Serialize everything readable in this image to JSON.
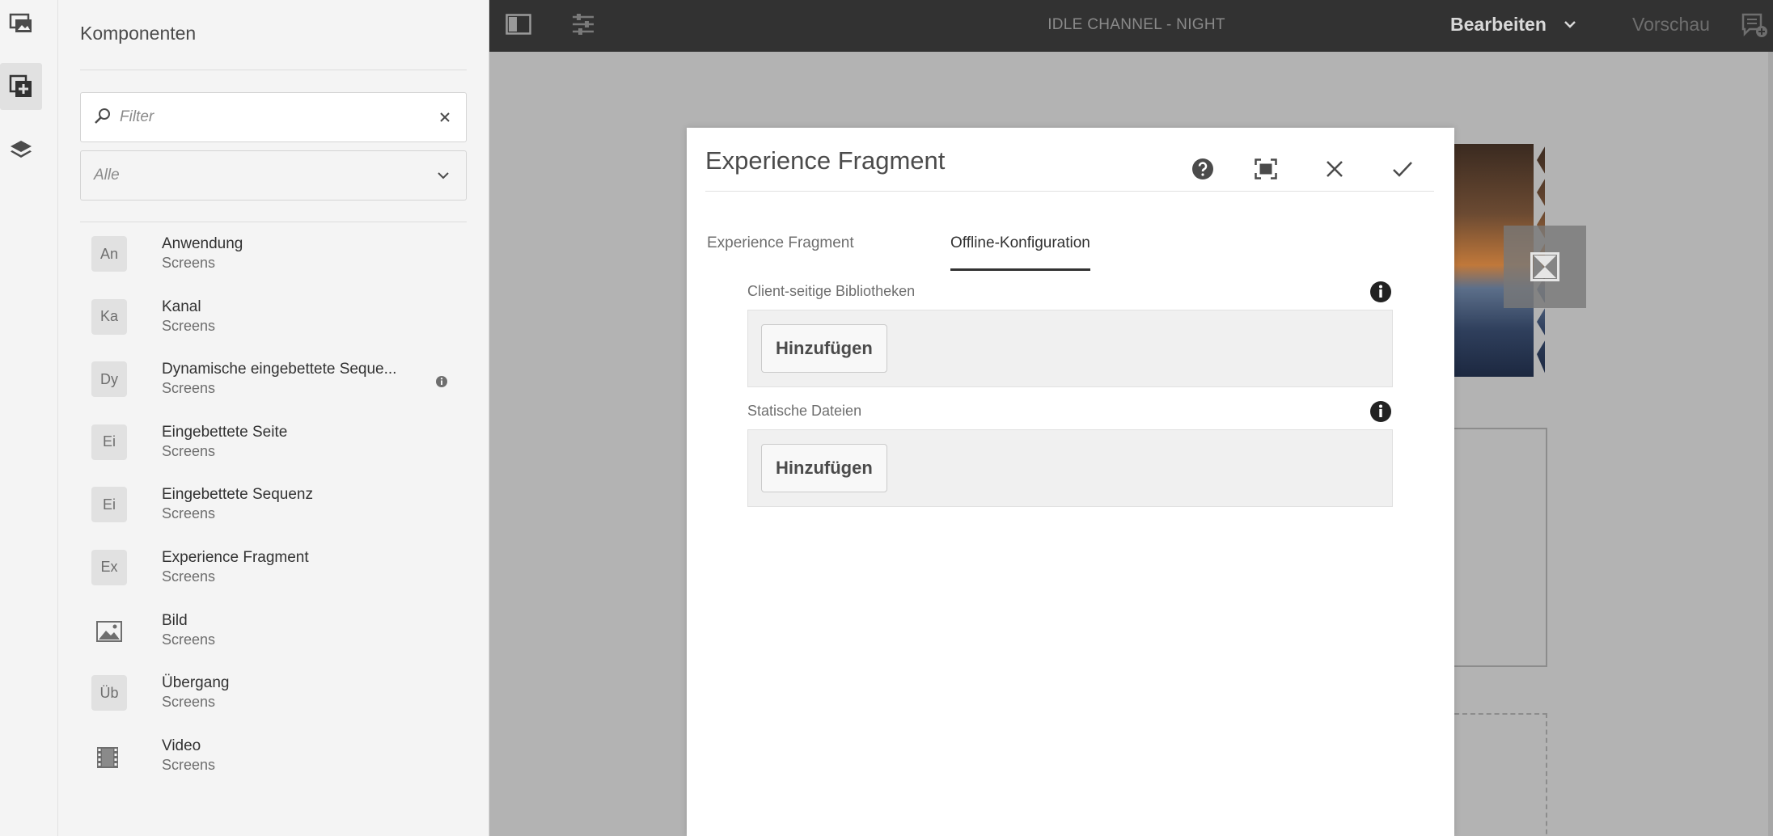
{
  "rail": {
    "items": [
      {
        "name": "assets-rail-icon"
      },
      {
        "name": "components-rail-icon",
        "active": true
      },
      {
        "name": "content-tree-rail-icon"
      }
    ]
  },
  "panel": {
    "title": "Komponenten",
    "filter": {
      "placeholder": "Filter"
    },
    "group_select": {
      "value": "Alle"
    },
    "components": [
      {
        "badge": "An",
        "name": "Anwendung",
        "group": "Screens"
      },
      {
        "badge": "Ka",
        "name": "Kanal",
        "group": "Screens"
      },
      {
        "badge": "Dy",
        "name": "Dynamische eingebettete Seque...",
        "group": "Screens",
        "info": true
      },
      {
        "badge": "Ei",
        "name": "Eingebettete Seite",
        "group": "Screens"
      },
      {
        "badge": "Ei",
        "name": "Eingebettete Sequenz",
        "group": "Screens"
      },
      {
        "badge": "Ex",
        "name": "Experience Fragment",
        "group": "Screens"
      },
      {
        "badge": "",
        "icon": "image-icon",
        "name": "Bild",
        "group": "Screens"
      },
      {
        "badge": "Üb",
        "name": "Übergang",
        "group": "Screens"
      },
      {
        "badge": "",
        "icon": "video-icon",
        "name": "Video",
        "group": "Screens"
      }
    ]
  },
  "toolbar": {
    "title": "IDLE CHANNEL - NIGHT",
    "mode": "Bearbeiten",
    "preview": "Vorschau"
  },
  "dialog": {
    "title": "Experience Fragment",
    "tabs": [
      {
        "label": "Experience Fragment",
        "active": false
      },
      {
        "label": "Offline-Konfiguration",
        "active": true
      }
    ],
    "fields": [
      {
        "label": "Client-seitige Bibliotheken",
        "button": "Hinzufügen"
      },
      {
        "label": "Statische Dateien",
        "button": "Hinzufügen"
      }
    ]
  },
  "colors": {
    "toolbar_bg": "#323232",
    "panel_bg": "#f4f4f4",
    "canvas_bg": "#b3b3b3",
    "dialog_bg": "#ffffff"
  }
}
